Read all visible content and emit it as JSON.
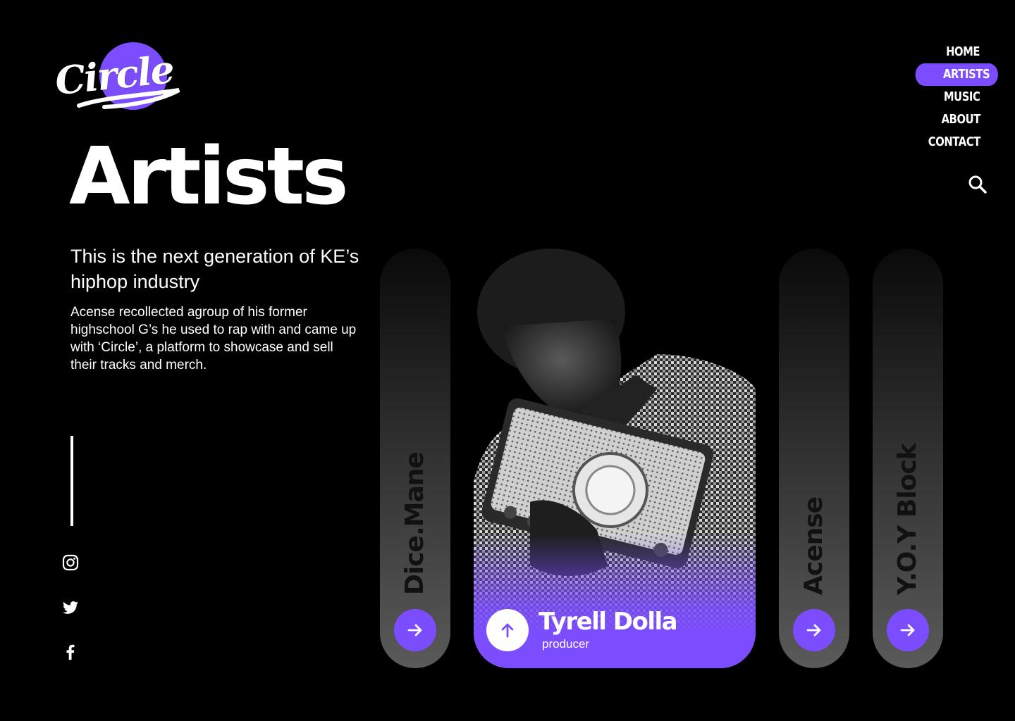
{
  "brand": {
    "logo_text": "Circle",
    "accent": "#7c4dff"
  },
  "nav": {
    "items": [
      {
        "label": "HOME",
        "active": false
      },
      {
        "label": "ARTISTS",
        "active": true
      },
      {
        "label": "MUSIC",
        "active": false
      },
      {
        "label": "ABOUT",
        "active": false
      },
      {
        "label": "CONTACT",
        "active": false
      }
    ],
    "search_icon": "search-icon"
  },
  "hero": {
    "title": "Artists",
    "subtitle": "This is the next generation of KE’s hiphop industry",
    "description": "Acense recollected agroup of his former highschool G’s he used to rap with and came up with ‘Circle’, a platform to showcase and sell their tracks and merch."
  },
  "social": [
    "instagram-icon",
    "twitter-icon",
    "facebook-icon"
  ],
  "artists": {
    "side_left": {
      "name": "Dice.Mane"
    },
    "featured": {
      "name": "Tyrell Dolla",
      "role": "producer"
    },
    "side_right_1": {
      "name": "Acense"
    },
    "side_right_2": {
      "name": "Y.O.Y Block"
    }
  }
}
